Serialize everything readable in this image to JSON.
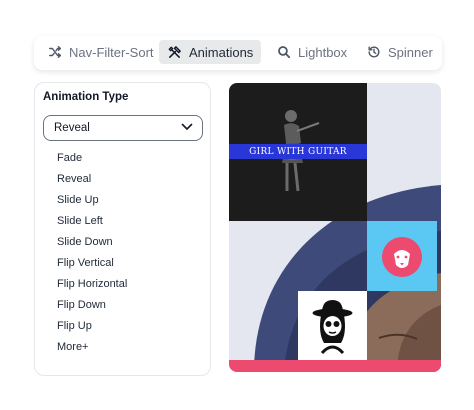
{
  "tabs": [
    {
      "label": "Nav-Filter-Sort",
      "icon": "shuffle-icon",
      "active": false
    },
    {
      "label": "Animations",
      "icon": "tools-icon",
      "active": true
    },
    {
      "label": "Lightbox",
      "icon": "search-icon",
      "active": false
    },
    {
      "label": "Spinner",
      "icon": "history-icon",
      "active": false
    }
  ],
  "sidebar": {
    "title": "Animation Type",
    "select": {
      "value": "Reveal"
    },
    "options": [
      "Fade",
      "Reveal",
      "Slide Up",
      "Slide Left",
      "Slide Down",
      "Flip Vertical",
      "Flip Horizontal",
      "Flip Down",
      "Flip Up",
      "More+"
    ]
  },
  "gallery": {
    "guitar_caption": "GIRL WITH GUITAR",
    "colors": {
      "dark_tile": "#1c1c1d",
      "banner": "#2a37d8",
      "blue_tile": "#5bc8f4",
      "lion": "#ec4a6e",
      "accent_bar": "#ec4a6e",
      "photo_background": "#e4e7ef",
      "hood": "#3d4a7a"
    }
  }
}
